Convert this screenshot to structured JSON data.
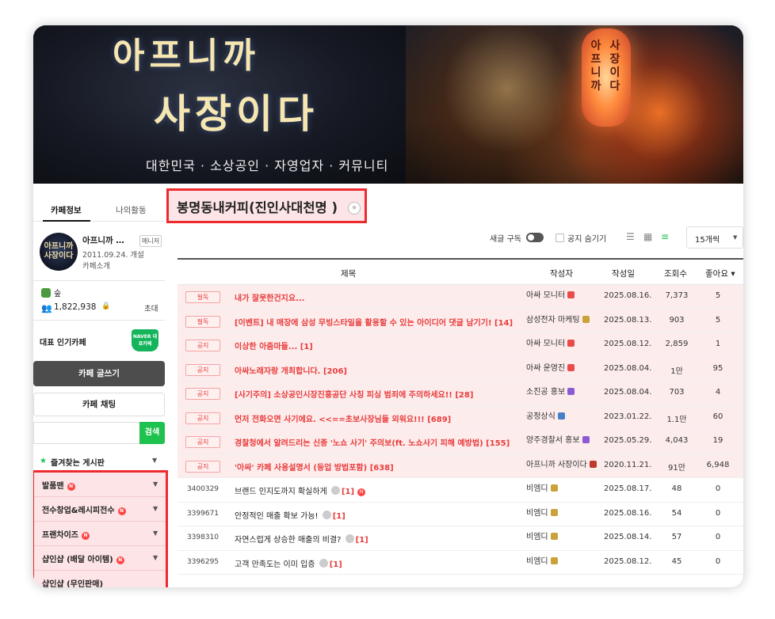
{
  "banner": {
    "title_line1": "아프니까",
    "title_line2": "사장이다",
    "subtitle": "대한민국 · 소상공인 · 자영업자 · 커뮤니티",
    "lantern_left": "아프니까",
    "lantern_right": "사장이다"
  },
  "sidebar": {
    "tab_info": "카페정보",
    "tab_activity": "나의활동",
    "thumb_text": "아프니까 사장이다",
    "cafe_name": "아프니까 …",
    "manager_badge": "매니저",
    "founded": "2011.09.24. 개설",
    "intro_link": "카페소개",
    "grade": "숲",
    "member_count": "1,822,938",
    "invite": "초대",
    "rep_label": "대표 인기카페",
    "naver_badge": "NAVER 대표카페",
    "write_button": "카페 글쓰기",
    "chat_button": "카페 채팅",
    "search_placeholder": "",
    "search_button": "검색",
    "favorites_label": "즐겨찾는 게시판",
    "boards": [
      {
        "label": "발품맨"
      },
      {
        "label": "전수창업&레시피전수"
      },
      {
        "label": "프랜차이즈"
      },
      {
        "label": "샵인샵 (배달 아이템)"
      },
      {
        "label": "샵인샵 (무인판매)"
      }
    ],
    "new_badge": "N"
  },
  "main": {
    "board_title": "봉명동내커피(진인사대천명 )",
    "toolbar": {
      "subscribe": "새글 구독",
      "hide_notices": "공지 숨기기",
      "per_page": "15개씩"
    },
    "columns": {
      "title": "제목",
      "author": "작성자",
      "date": "작성일",
      "views": "조회수",
      "likes": "좋아요"
    },
    "rows": [
      {
        "tag": "필독",
        "title": "내가 잘못한건지요...",
        "comments": "",
        "author": "아싸 모니터",
        "level_color": "#e94b4b",
        "date": "2025.08.16.",
        "views": "7,373",
        "likes": "5"
      },
      {
        "tag": "필독",
        "title": "[이벤트] 내 매장에 삼성 무빙스타일을 활용할 수 있는 아이디어 댓글 남기기!",
        "comments": "[14]",
        "author": "삼성전자 마케팅",
        "level_color": "#c9a23a",
        "date": "2025.08.13.",
        "views": "903",
        "likes": "5"
      },
      {
        "tag": "공지",
        "title": "이상한 아줌마들...",
        "comments": "[1]",
        "author": "아싸 모니터",
        "level_color": "#e94b4b",
        "date": "2025.08.12.",
        "views": "2,859",
        "likes": "1"
      },
      {
        "tag": "공지",
        "title": "아싸노래자랑 개최합니다.",
        "comments": "[206]",
        "author": "아싸 운영진",
        "level_color": "#e94b4b",
        "date": "2025.08.04.",
        "views": "1만",
        "likes": "95"
      },
      {
        "tag": "공지",
        "title": "[사기주의] 소상공인시장진흥공단 사칭 피싱 범죄에 주의하세요!!",
        "comments": "[28]",
        "author": "소진공 홍보",
        "level_color": "#8a5bd6",
        "date": "2025.08.04.",
        "views": "703",
        "likes": "4"
      },
      {
        "tag": "공지",
        "title": "먼저 전화오면 사기에요. <<==초보사장님들 외워요!!!",
        "comments": "[689]",
        "author": "공정상식",
        "level_color": "#4a7ec9",
        "date": "2023.01.22.",
        "views": "1.1만",
        "likes": "60"
      },
      {
        "tag": "공지",
        "title": "경찰청에서 알려드리는 신종 '노쇼 사기' 주의보(ft. 노쇼사기 피해 예방법)",
        "comments": "[155]",
        "author": "양주경찰서 홍보",
        "level_color": "#8a5bd6",
        "date": "2025.05.29.",
        "views": "4,043",
        "likes": "19"
      },
      {
        "tag": "공지",
        "title": "'아싸' 카페 사용설명서 (등업 방법포함)",
        "comments": "[638]",
        "author": "아프니까 사장이다",
        "level_color": "#c0392b",
        "date": "2020.11.21.",
        "views": "91만",
        "likes": "6,948"
      },
      {
        "no": "3400329",
        "title": "브랜드 인지도까지 확실하게",
        "comments": "[1]",
        "author": "비엠디",
        "level_color": "#c9a23a",
        "date": "2025.08.17.",
        "views": "48",
        "likes": "0"
      },
      {
        "no": "3399671",
        "title": "안정적인 매출 확보 가능!",
        "comments": "[1]",
        "author": "비엠디",
        "level_color": "#c9a23a",
        "date": "2025.08.16.",
        "views": "54",
        "likes": "0"
      },
      {
        "no": "3398310",
        "title": "자연스럽게 상승한 매출의 비결?",
        "comments": "[1]",
        "author": "비엠디",
        "level_color": "#c9a23a",
        "date": "2025.08.14.",
        "views": "57",
        "likes": "0"
      },
      {
        "no": "3396295",
        "title": "고객 만족도는 이미 입증",
        "comments": "[1]",
        "author": "비엠디",
        "level_color": "#c9a23a",
        "date": "2025.08.12.",
        "views": "45",
        "likes": "0"
      }
    ]
  },
  "colors": {
    "highlight_border": "#ef2a2e",
    "highlight_fill": "#fde4e6",
    "naver_green": "#1ec24f",
    "notice_red": "#e93c3c"
  }
}
